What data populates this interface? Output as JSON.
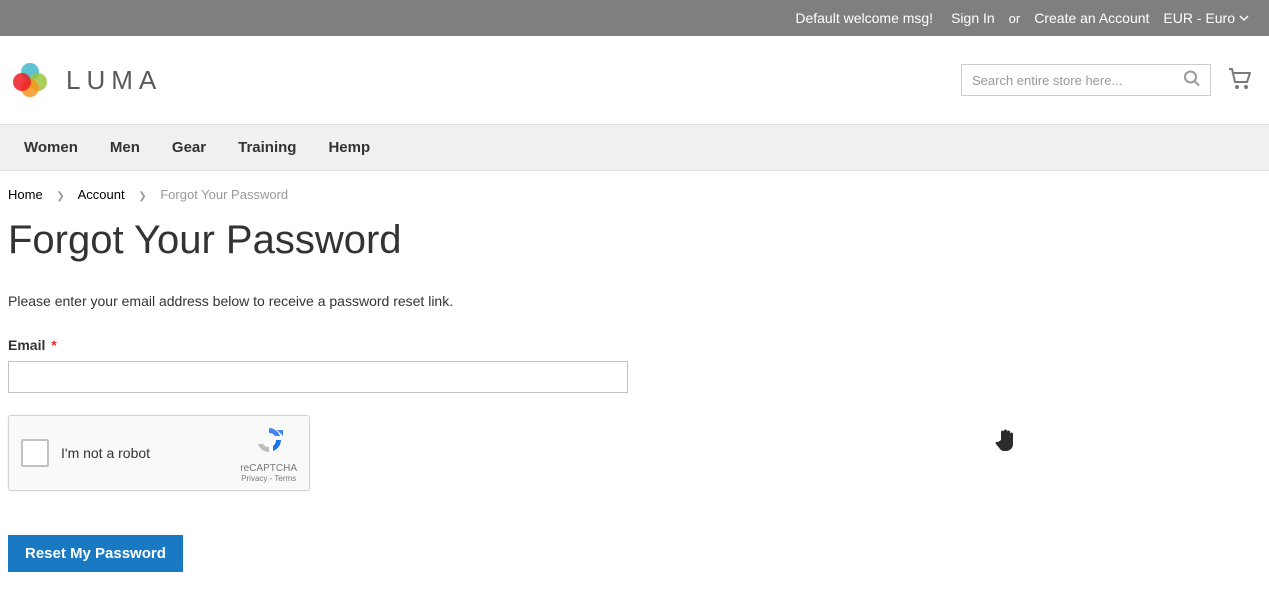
{
  "panel": {
    "welcome": "Default welcome msg!",
    "sign_in": "Sign In",
    "or": "or",
    "create_account": "Create an Account",
    "currency": "EUR - Euro"
  },
  "logo": {
    "text": "LUMA"
  },
  "search": {
    "placeholder": "Search entire store here..."
  },
  "nav": {
    "items": [
      {
        "label": "Women"
      },
      {
        "label": "Men"
      },
      {
        "label": "Gear"
      },
      {
        "label": "Training"
      },
      {
        "label": "Hemp"
      }
    ]
  },
  "breadcrumbs": {
    "home": "Home",
    "account": "Account",
    "current": "Forgot Your Password"
  },
  "page": {
    "title": "Forgot Your Password",
    "note": "Please enter your email address below to receive a password reset link.",
    "email_label": "Email",
    "required_mark": "*"
  },
  "recaptcha": {
    "label": "I'm not a robot",
    "brand": "reCAPTCHA",
    "links": "Privacy - Terms"
  },
  "actions": {
    "submit": "Reset My Password"
  }
}
